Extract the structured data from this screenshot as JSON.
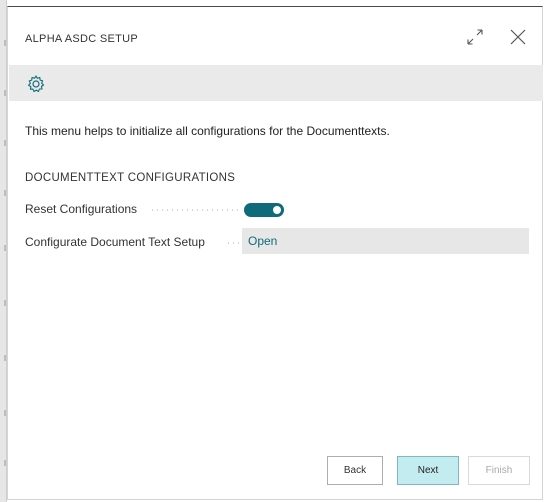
{
  "dialog": {
    "title": "ALPHA ASDC SETUP",
    "icons": {
      "expand": "expand-icon",
      "close": "close-icon",
      "settings": "gear-icon"
    }
  },
  "intro_text": "This menu helps to initialize all configurations for the Documenttexts.",
  "section": {
    "header": "DOCUMENTTEXT CONFIGURATIONS",
    "fields": [
      {
        "label": "Reset Configurations",
        "type": "toggle",
        "value": true
      },
      {
        "label": "Configurate Document Text Setup",
        "type": "link",
        "value": "Open"
      }
    ]
  },
  "footer": {
    "back_label": "Back",
    "next_label": "Next",
    "finish_label": "Finish"
  },
  "colors": {
    "accent": "#0f6b7a",
    "next_button_bg": "#c3ecf1",
    "action_bar_bg": "#eaeaea"
  }
}
